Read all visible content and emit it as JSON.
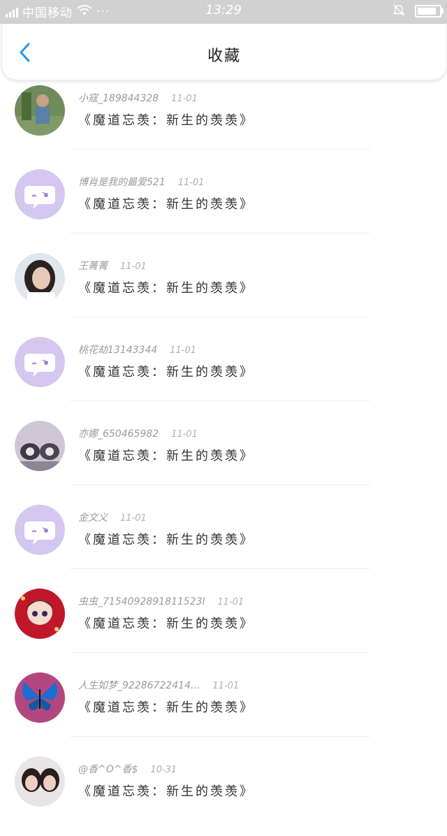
{
  "status_bar": {
    "signal": "4G",
    "carrier": "中国移动",
    "dots": "···",
    "time": "13:29"
  },
  "header": {
    "title": "收藏"
  },
  "items": [
    {
      "user": "小寇_189844328",
      "date": "11-01",
      "title": "《魔道忘羡：新生的羡羡》",
      "avatar": "photo"
    },
    {
      "user": "博肖是我的最爱521",
      "date": "11-01",
      "title": "《魔道忘羡：新生的羡羡》",
      "avatar": "default"
    },
    {
      "user": "王菁菁",
      "date": "11-01",
      "title": "《魔道忘羡：新生的羡羡》",
      "avatar": "photo"
    },
    {
      "user": "桃花劫13143344",
      "date": "11-01",
      "title": "《魔道忘羡：新生的羡羡》",
      "avatar": "default"
    },
    {
      "user": "亦娜_650465982",
      "date": "11-01",
      "title": "《魔道忘羡：新生的羡羡》",
      "avatar": "photo"
    },
    {
      "user": "金文义",
      "date": "11-01",
      "title": "《魔道忘羡：新生的羡羡》",
      "avatar": "default"
    },
    {
      "user": "虫虫_7154092891811523l",
      "date": "11-01",
      "title": "《魔道忘羡：新生的羡羡》",
      "avatar": "photo"
    },
    {
      "user": "人生如梦_92286722414...",
      "date": "11-01",
      "title": "《魔道忘羡：新生的羡羡》",
      "avatar": "photo"
    },
    {
      "user": "@香^O^香$",
      "date": "10-31",
      "title": "《魔道忘羡：新生的羡羡》",
      "avatar": "photo"
    }
  ]
}
